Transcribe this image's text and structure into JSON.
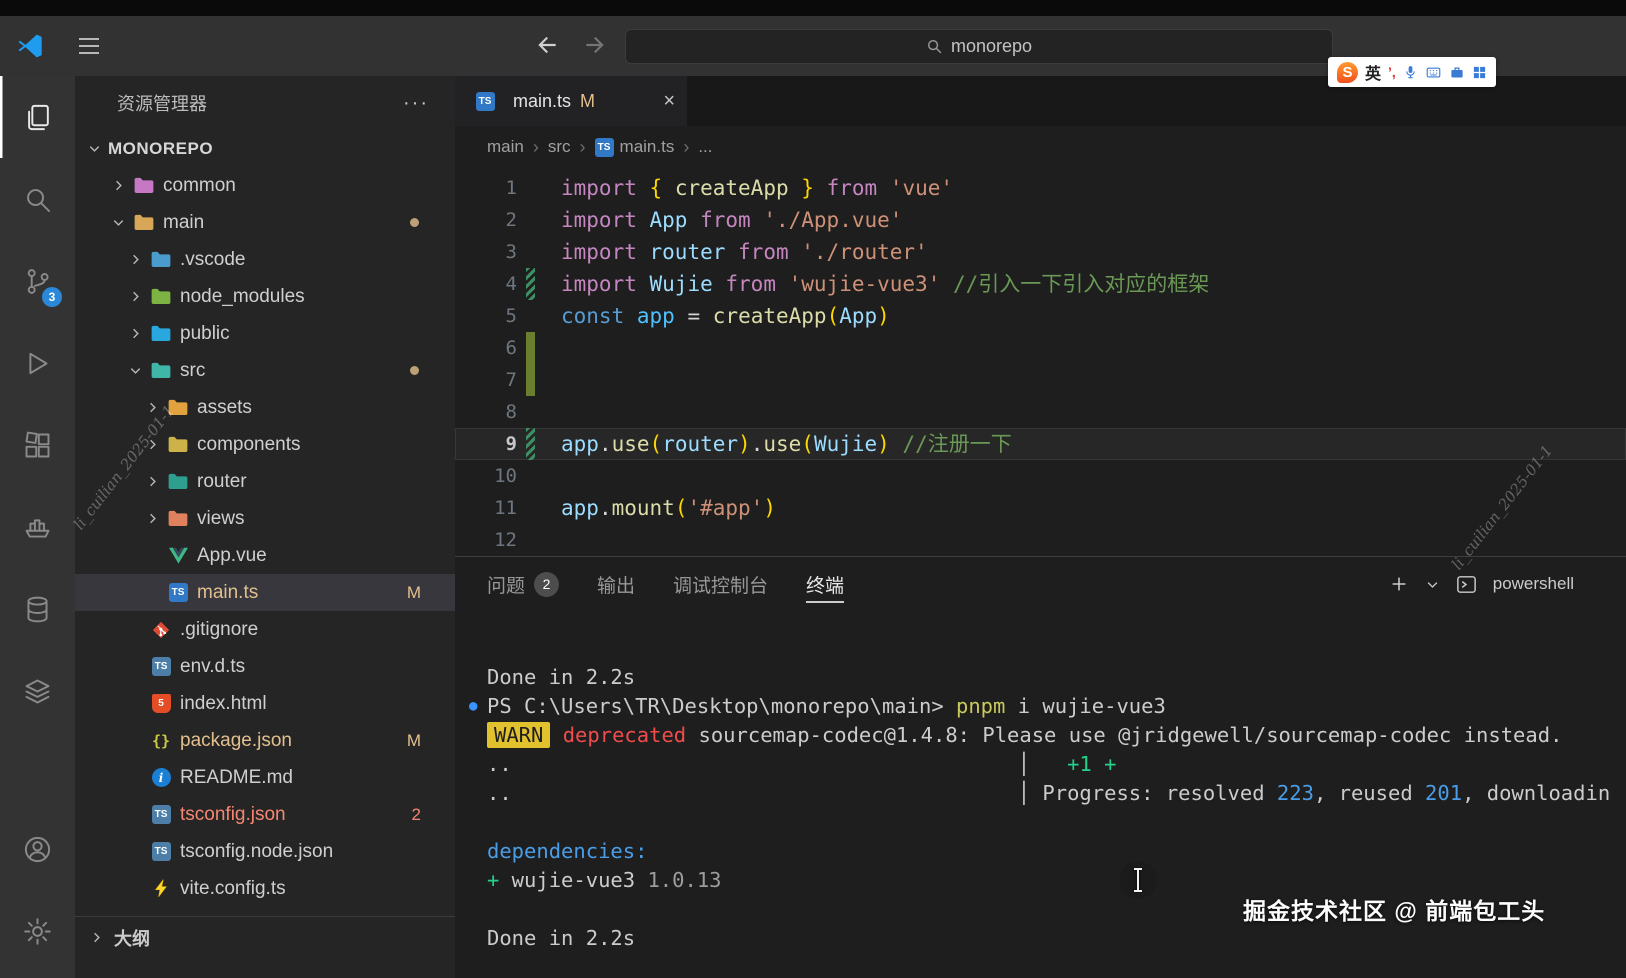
{
  "palette": {
    "accent_blue": "#2b88d8",
    "modified_yellow": "#e2c08d",
    "error_red": "#f48771",
    "warn_bg": "#e2c12e",
    "term_red": "#f14c4c",
    "term_green": "#23d18b",
    "term_blue": "#4a9ee8",
    "term_yellow": "#c9c95c",
    "term_dim": "#9d9d9d",
    "bullet_blue": "#3794ff"
  },
  "titlebar": {
    "search_value": "monorepo",
    "ime": {
      "lang": "英",
      "punct": "’,"
    }
  },
  "activity_bar": {
    "top": [
      {
        "name": "explorer",
        "active": true
      },
      {
        "name": "search"
      },
      {
        "name": "source-control",
        "badge": "3"
      },
      {
        "name": "run-debug"
      },
      {
        "name": "extensions"
      },
      {
        "name": "remote-docker"
      },
      {
        "name": "database"
      },
      {
        "name": "layers"
      }
    ],
    "bottom": [
      {
        "name": "account"
      },
      {
        "name": "settings"
      }
    ]
  },
  "sidebar": {
    "title": "资源管理器",
    "more_label": "···",
    "root": {
      "label": "MONOREPO"
    },
    "items": [
      {
        "label": "common",
        "indent": 1,
        "arrow": "right",
        "icon": "folder",
        "color": "#c678c4"
      },
      {
        "label": "main",
        "indent": 1,
        "arrow": "down",
        "icon": "folder",
        "color": "#d8a657",
        "dot": true
      },
      {
        "label": ".vscode",
        "indent": 2,
        "arrow": "right",
        "icon": "folder",
        "color": "#4a9ccd"
      },
      {
        "label": "node_modules",
        "indent": 2,
        "arrow": "right",
        "icon": "folder",
        "color": "#7cb342"
      },
      {
        "label": "public",
        "indent": 2,
        "arrow": "right",
        "icon": "folder",
        "color": "#29a8df"
      },
      {
        "label": "src",
        "indent": 2,
        "arrow": "down",
        "icon": "folder",
        "color": "#3fb6a8",
        "dot": true
      },
      {
        "label": "assets",
        "indent": 3,
        "arrow": "right",
        "icon": "folder",
        "color": "#e2a33e"
      },
      {
        "label": "components",
        "indent": 3,
        "arrow": "right",
        "icon": "folder",
        "color": "#cdb24a"
      },
      {
        "label": "router",
        "indent": 3,
        "arrow": "right",
        "icon": "folder",
        "color": "#2e9f8f"
      },
      {
        "label": "views",
        "indent": 3,
        "arrow": "right",
        "icon": "folder",
        "color": "#e0815e"
      },
      {
        "label": "App.vue",
        "indent": 3,
        "icon": "vue"
      },
      {
        "label": "main.ts",
        "indent": 3,
        "icon": "ts",
        "badge": "M",
        "selected": true,
        "modified": true
      },
      {
        "label": ".gitignore",
        "indent": 2,
        "icon": "git"
      },
      {
        "label": "env.d.ts",
        "indent": 2,
        "icon": "ts2"
      },
      {
        "label": "index.html",
        "indent": 2,
        "icon": "html"
      },
      {
        "label": "package.json",
        "indent": 2,
        "icon": "json",
        "badge": "M",
        "modified": true
      },
      {
        "label": "README.md",
        "indent": 2,
        "icon": "info"
      },
      {
        "label": "tsconfig.json",
        "indent": 2,
        "icon": "ts2",
        "badge": "2",
        "error": true
      },
      {
        "label": "tsconfig.node.json",
        "indent": 2,
        "icon": "ts2"
      },
      {
        "label": "vite.config.ts",
        "indent": 2,
        "icon": "vite"
      }
    ],
    "outline": {
      "label": "大纲"
    }
  },
  "editor": {
    "tab": {
      "label": "main.ts",
      "git_status": "M",
      "close": "×"
    },
    "breadcrumb": [
      {
        "label": "main"
      },
      {
        "label": "src"
      },
      {
        "label": "main.ts",
        "icon": "ts"
      },
      {
        "label": "..."
      }
    ],
    "lines": [
      {
        "n": 1,
        "tokens": [
          [
            "import",
            "kw"
          ],
          [
            " ",
            "pl"
          ],
          [
            "{",
            "b1"
          ],
          [
            " ",
            "pl"
          ],
          [
            "createApp",
            "fn"
          ],
          [
            " ",
            "pl"
          ],
          [
            "}",
            "b1"
          ],
          [
            " ",
            "pl"
          ],
          [
            "from",
            "kw"
          ],
          [
            " ",
            "pl"
          ],
          [
            "'vue'",
            "str"
          ]
        ]
      },
      {
        "n": 2,
        "tokens": [
          [
            "import",
            "kw"
          ],
          [
            " ",
            "pl"
          ],
          [
            "App",
            "id"
          ],
          [
            " ",
            "pl"
          ],
          [
            "from",
            "kw"
          ],
          [
            " ",
            "pl"
          ],
          [
            "'./App.vue'",
            "str"
          ]
        ]
      },
      {
        "n": 3,
        "tokens": [
          [
            "import",
            "kw"
          ],
          [
            " ",
            "pl"
          ],
          [
            "router",
            "id"
          ],
          [
            " ",
            "pl"
          ],
          [
            "from",
            "kw"
          ],
          [
            " ",
            "pl"
          ],
          [
            "'./router'",
            "str"
          ]
        ]
      },
      {
        "n": 4,
        "gutter": "striped",
        "tokens": [
          [
            "import",
            "kw"
          ],
          [
            " ",
            "pl"
          ],
          [
            "Wujie",
            "id"
          ],
          [
            " ",
            "pl"
          ],
          [
            "from",
            "kw"
          ],
          [
            " ",
            "pl"
          ],
          [
            "'wujie-vue3'",
            "str"
          ],
          [
            " ",
            "pl"
          ],
          [
            "//引入一下引入对应的框架",
            "cm"
          ]
        ]
      },
      {
        "n": 5,
        "tokens": [
          [
            "const",
            "key"
          ],
          [
            " ",
            "pl"
          ],
          [
            "app",
            "cv"
          ],
          [
            " ",
            "pl"
          ],
          [
            "=",
            "pl"
          ],
          [
            " ",
            "pl"
          ],
          [
            "createApp",
            "fn"
          ],
          [
            "(",
            "b1"
          ],
          [
            "App",
            "id"
          ],
          [
            ")",
            "b1"
          ]
        ]
      },
      {
        "n": 6,
        "gutter": "solid",
        "tokens": []
      },
      {
        "n": 7,
        "gutter": "solid",
        "tokens": []
      },
      {
        "n": 8,
        "tokens": []
      },
      {
        "n": 9,
        "active": true,
        "gutter": "striped",
        "tokens": [
          [
            "app",
            "id"
          ],
          [
            ".",
            "pl"
          ],
          [
            "use",
            "fn"
          ],
          [
            "(",
            "b1"
          ],
          [
            "router",
            "id"
          ],
          [
            ")",
            "b1"
          ],
          [
            ".",
            "pl"
          ],
          [
            "use",
            "fn"
          ],
          [
            "(",
            "b1"
          ],
          [
            "Wujie",
            "id"
          ],
          [
            ")",
            "b1"
          ],
          [
            " ",
            "pl"
          ],
          [
            "//注册一下",
            "cm"
          ]
        ]
      },
      {
        "n": 10,
        "tokens": []
      },
      {
        "n": 11,
        "tokens": [
          [
            "app",
            "id"
          ],
          [
            ".",
            "pl"
          ],
          [
            "mount",
            "fn"
          ],
          [
            "(",
            "b1"
          ],
          [
            "'#app'",
            "str"
          ],
          [
            ")",
            "b1"
          ]
        ]
      },
      {
        "n": 12,
        "tokens": []
      }
    ]
  },
  "panel": {
    "tabs": [
      {
        "label": "问题",
        "badge": "2"
      },
      {
        "label": "输出"
      },
      {
        "label": "调试控制台"
      },
      {
        "label": "终端",
        "active": true
      }
    ],
    "shell_label": "powershell",
    "terminal": [
      {
        "tokens": [
          [
            "Done in 2.2s",
            "pl"
          ]
        ]
      },
      {
        "bullet": true,
        "tokens": [
          [
            "PS C:\\Users\\TR\\Desktop\\monorepo\\main> ",
            "pl"
          ],
          [
            "pnpm",
            "yellow"
          ],
          [
            " i wujie-vue3",
            "pl"
          ]
        ]
      },
      {
        "tokens": [
          [
            "WARN",
            "warn"
          ],
          [
            " ",
            "pl"
          ],
          [
            "deprecated",
            "red"
          ],
          [
            " sourcemap-codec@1.4.8: Please use @jridgewell/sourcemap-codec instead.",
            "pl"
          ]
        ]
      },
      {
        "tokens": [
          [
            "..",
            "pl"
          ],
          [
            "                                         │   ",
            "pl"
          ],
          [
            "+1 +",
            "green"
          ]
        ]
      },
      {
        "tokens": [
          [
            "..",
            "pl"
          ],
          [
            "                                         │ Progress: resolved ",
            "pl"
          ],
          [
            "223",
            "blue"
          ],
          [
            ", reused ",
            "pl"
          ],
          [
            "201",
            "blue"
          ],
          [
            ", downloadin",
            "pl"
          ]
        ]
      },
      {
        "tokens": []
      },
      {
        "tokens": [
          [
            "dependencies:",
            "blue"
          ]
        ]
      },
      {
        "tokens": [
          [
            "+",
            "green"
          ],
          [
            " wujie-vue3 ",
            "pl"
          ],
          [
            "1.0.13",
            "dim"
          ]
        ]
      },
      {
        "tokens": []
      },
      {
        "tokens": [
          [
            "Done in 2.2s",
            "pl"
          ]
        ]
      }
    ]
  },
  "watermarks": {
    "community": "掘金技术社区 @ 前端包工头",
    "diagonal": "li_cuilian_2025-01-1"
  }
}
